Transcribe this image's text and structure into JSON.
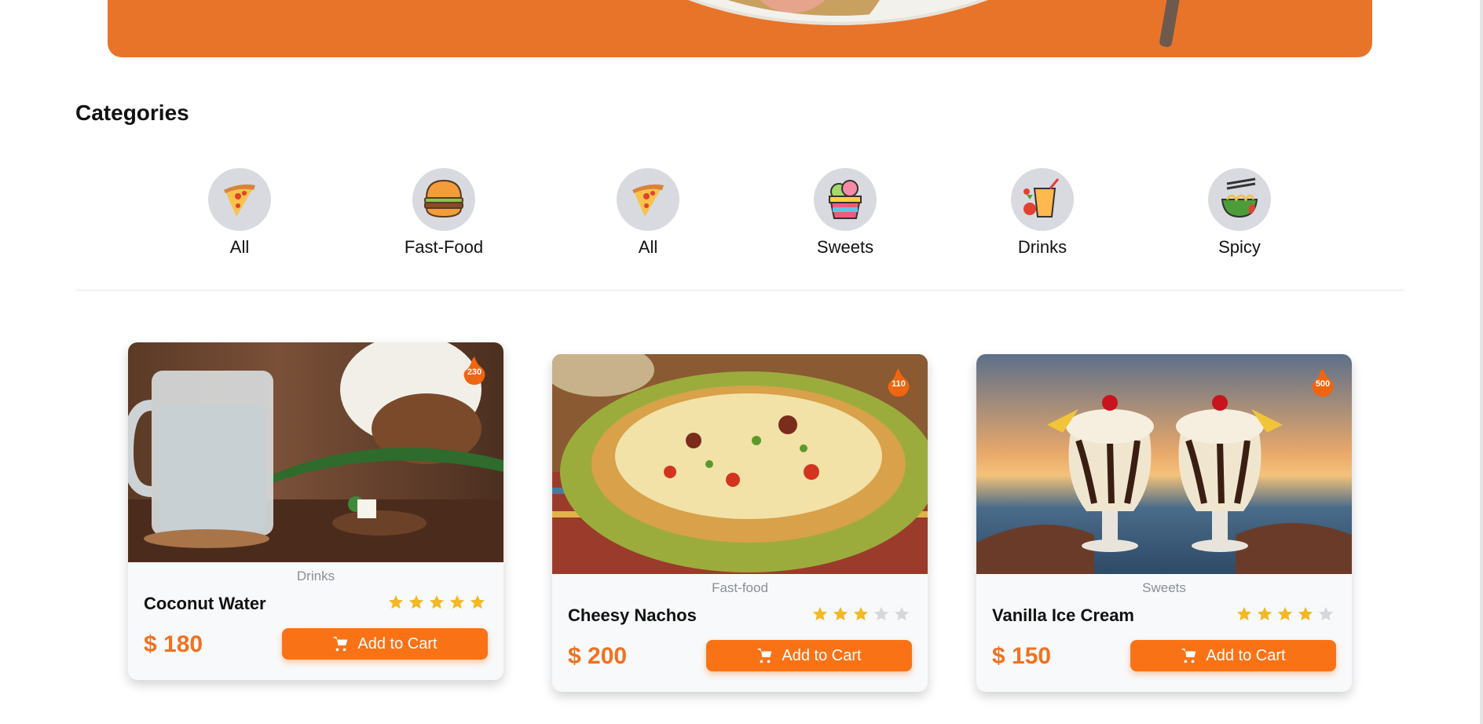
{
  "section": {
    "title": "Categories"
  },
  "categories": [
    {
      "label": "All",
      "icon": "pizza-icon"
    },
    {
      "label": "Fast-Food",
      "icon": "burger-icon"
    },
    {
      "label": "All",
      "icon": "pizza-icon"
    },
    {
      "label": "Sweets",
      "icon": "ice-cream-icon"
    },
    {
      "label": "Drinks",
      "icon": "drink-icon"
    },
    {
      "label": "Spicy",
      "icon": "noodle-bowl-icon"
    }
  ],
  "products": [
    {
      "category": "Drinks",
      "name": "Coconut Water",
      "rating": 5,
      "price": "$ 180",
      "calories": "230",
      "button": "Add to Cart"
    },
    {
      "category": "Fast-food",
      "name": "Cheesy Nachos",
      "rating": 3,
      "price": "$ 200",
      "calories": "110",
      "button": "Add to Cart"
    },
    {
      "category": "Sweets",
      "name": "Vanilla Ice Cream",
      "rating": 4,
      "price": "$ 150",
      "calories": "500",
      "button": "Add to Cart"
    }
  ],
  "colors": {
    "accent": "#f97316",
    "star_on": "#f2b924",
    "star_off": "#d5d7db",
    "badge": "#f0650f"
  }
}
